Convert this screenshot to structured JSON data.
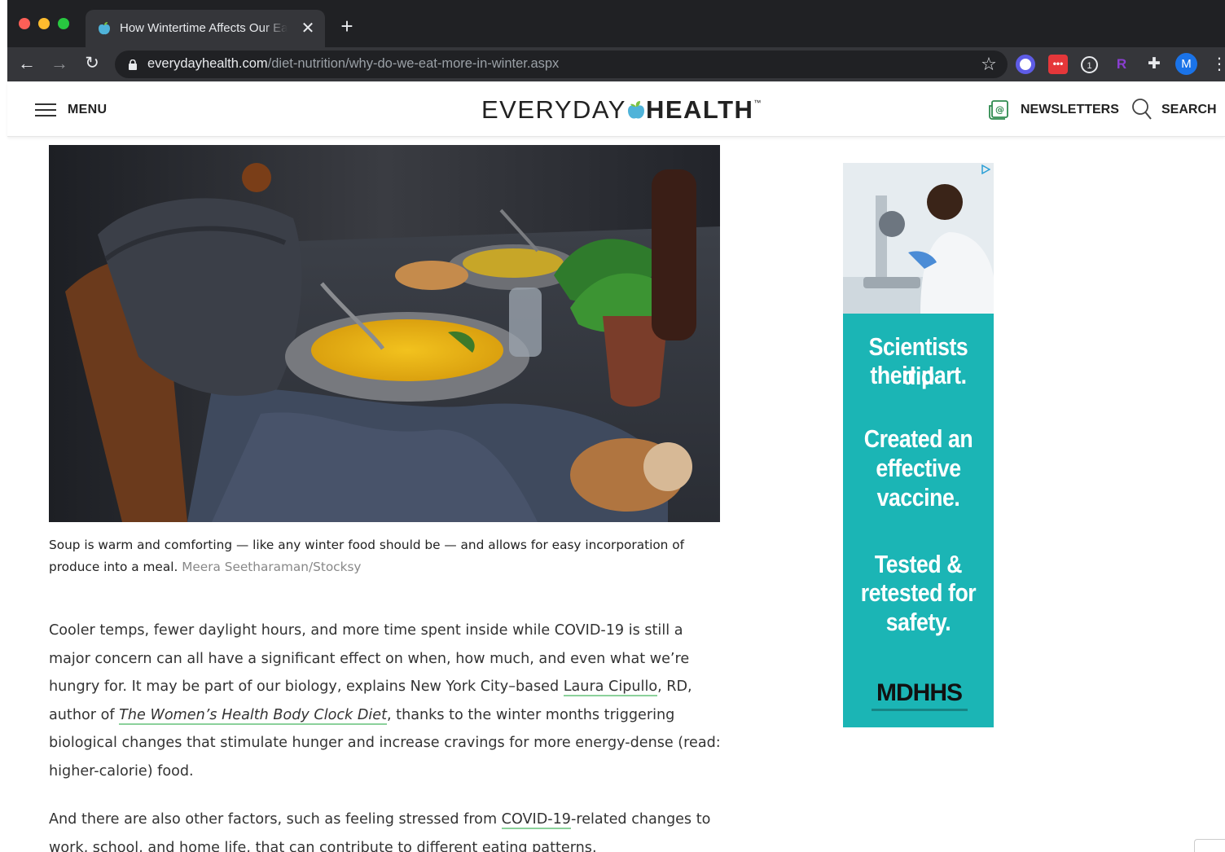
{
  "browser": {
    "tab_title": "How Wintertime Affects Our Eating Habits",
    "url_host": "everydayhealth.com",
    "url_path": "/diet-nutrition/why-do-we-eat-more-in-winter.aspx",
    "profile_initial": "M",
    "new_tab_symbol": "+",
    "close_symbol": "✕"
  },
  "header": {
    "menu_label": "MENU",
    "logo_left": "EVERYDAY",
    "logo_right": "HEALTH",
    "logo_tm": "™",
    "newsletters_label": "NEWSLETTERS",
    "search_label": "SEARCH"
  },
  "article": {
    "caption_text": "Soup is warm and comforting — like any winter food should be — and allows for easy incorporation of produce into a meal.",
    "caption_credit": "Meera Seetharaman/Stocksy",
    "p1_a": "Cooler temps, fewer daylight hours, and more time spent inside while COVID-19 is still a major concern can all have a significant effect on when, how much, and even what we’re hungry for. It may be part of our biology, explains New York City–based ",
    "p1_link1": "Laura Cipullo",
    "p1_b": ", RD, author of ",
    "p1_link2": "The Women’s Health Body Clock Diet",
    "p1_c": ", thanks to the winter months triggering biological changes that stimulate hunger and increase cravings for more energy-dense (read: higher-calorie) food.",
    "p2_a": "And there are also other factors, such as feeling stressed from ",
    "p2_link": "COVID-19",
    "p2_b": "-related changes to work, school, and home life, that can contribute to different eating patterns."
  },
  "ad": {
    "line1": "Scientists did",
    "line2": "their part.",
    "line3": "Created an",
    "line4": "effective",
    "line5": "vaccine.",
    "line6": "Tested &",
    "line7": "retested for",
    "line8": "safety.",
    "logo": "MDHHS"
  },
  "colors": {
    "chrome_dark": "#202124",
    "chrome_toolbar": "#35363a",
    "link_underline": "#8bd19b",
    "ad_teal": "#1bb5b5",
    "logo_apple": "#7cc242"
  }
}
